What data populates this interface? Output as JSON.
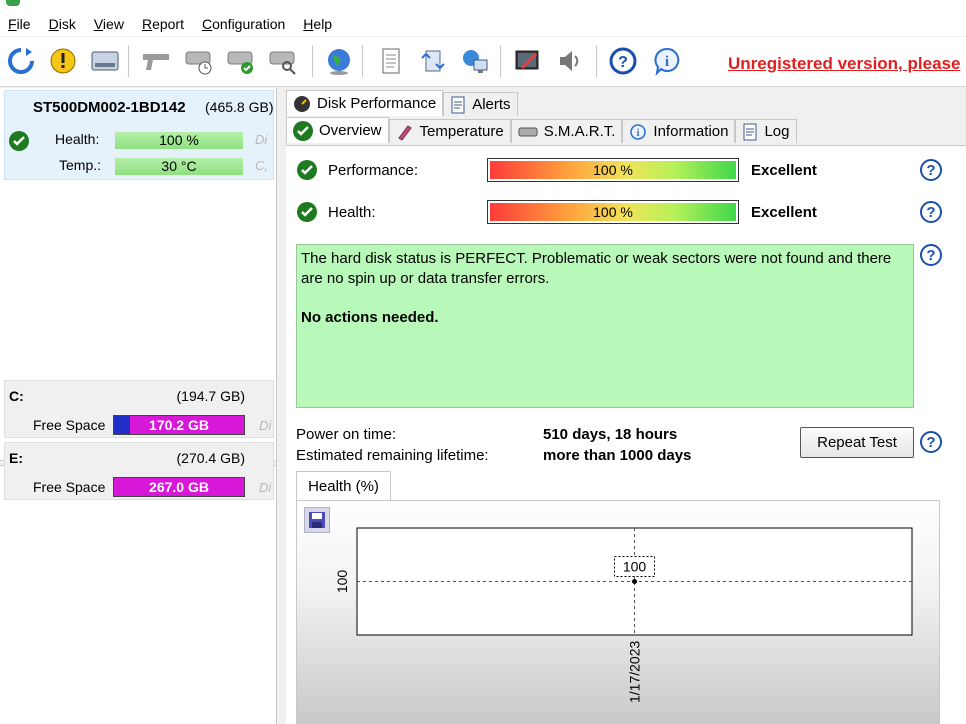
{
  "menu": [
    "File",
    "Disk",
    "View",
    "Report",
    "Configuration",
    "Help"
  ],
  "menu_underline": [
    "F",
    "D",
    "V",
    "R",
    "C",
    "H"
  ],
  "toolbar": {
    "icons": [
      "refresh-icon",
      "alert-icon",
      "disk-icon",
      "gun-icon",
      "disk-check-icon",
      "disk-ok-icon",
      "disk-search-icon",
      "globe-icon",
      "notepad-icon",
      "sync-icon",
      "network-icon",
      "edit-icon",
      "sound-icon",
      "help-icon",
      "info-icon"
    ],
    "unregistered": "Unregistered version, please"
  },
  "disk": {
    "name": "ST500DM002-1BD142",
    "size": "(465.8 GB)",
    "health_label": "Health:",
    "health_value": "100 %",
    "health_suffix": "Di",
    "temp_label": "Temp.:",
    "temp_value": "30 °C",
    "temp_suffix": "C,"
  },
  "volumes": [
    {
      "letter": "C:",
      "size": "(194.7 GB)",
      "free_label": "Free Space",
      "free_value": "170.2 GB",
      "used_fraction": 0.126,
      "suffix": "Di"
    },
    {
      "letter": "E:",
      "size": "(270.4 GB)",
      "free_label": "Free Space",
      "free_value": "267.0 GB",
      "used_fraction": 0.0,
      "suffix": "Di"
    }
  ],
  "tabs_top": [
    "Disk Performance",
    "Alerts"
  ],
  "tabs_main": [
    "Overview",
    "Temperature",
    "S.M.A.R.T.",
    "Information",
    "Log"
  ],
  "overview": {
    "performance_label": "Performance:",
    "performance_value": "100 %",
    "performance_rating": "Excellent",
    "health_label": "Health:",
    "health_value": "100 %",
    "health_rating": "Excellent",
    "status_text": "The hard disk status is PERFECT. Problematic or weak sectors were not found and there are no spin up or data transfer errors.",
    "status_action": "No actions needed.",
    "power_on_label": "Power on time:",
    "power_on_value": "510 days, 18 hours",
    "lifetime_label": "Estimated remaining lifetime:",
    "lifetime_value": "more than 1000 days",
    "repeat_button": "Repeat Test",
    "health_tab": "Health (%)"
  },
  "chart_data": {
    "type": "line",
    "x": [
      "1/17/2023"
    ],
    "series": [
      {
        "values": [
          100
        ]
      }
    ],
    "data_labels": [
      "100"
    ],
    "y_ticks": [
      "100"
    ],
    "x_ticks": [
      "1/17/2023"
    ],
    "grid": true
  }
}
